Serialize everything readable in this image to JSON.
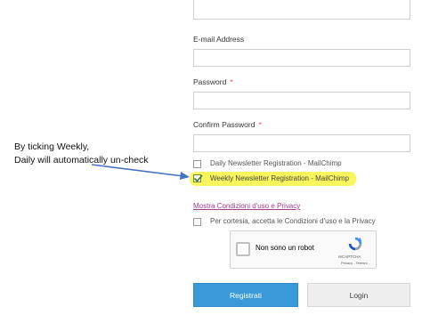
{
  "form": {
    "email_label": "E-mail Address",
    "password_label": "Password",
    "confirm_password_label": "Confirm Password",
    "required_marker": "*",
    "checkboxes": [
      {
        "label": "Daily Newsletter Registration - MailChimp",
        "checked": false
      },
      {
        "label": "Weekly Newsletter Registration - MailChimp",
        "checked": true
      }
    ],
    "terms_link": "Mostra Condizioni d'uso e Privacy",
    "terms_checkbox_label": "Per cortesia, accetta le Condizioni d'uso e la Privacy",
    "captcha": {
      "label": "Non sono un robot",
      "brand": "reCAPTCHA",
      "terms": "Privacy - Termini"
    },
    "register_button": "Registrati",
    "login_button": "Login"
  },
  "annotation": {
    "line1": "By ticking Weekly,",
    "line2": "Daily will automatically un-check",
    "highlight_color": "#f7f54a",
    "arrow_color": "#4472c4"
  },
  "colors": {
    "primary_button": "#3a9ad9",
    "link": "#a03c8c",
    "required": "#e05050"
  }
}
